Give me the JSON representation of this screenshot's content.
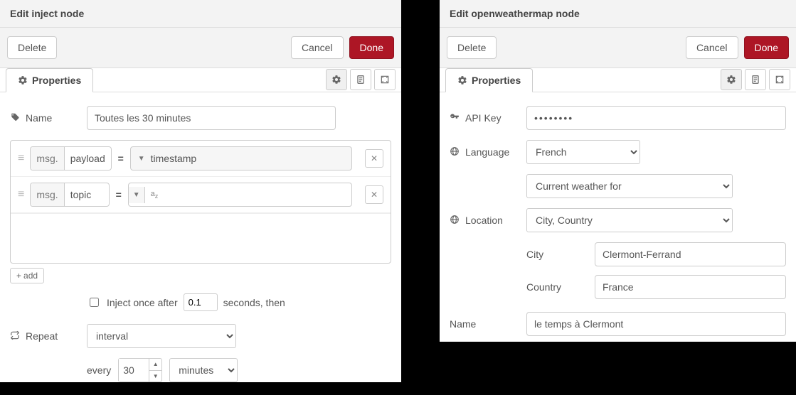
{
  "left": {
    "title": "Edit inject node",
    "delete_label": "Delete",
    "cancel_label": "Cancel",
    "done_label": "Done",
    "tab_label": "Properties",
    "name_label": "Name",
    "name_value": "Toutes les 30 minutes",
    "rows": [
      {
        "prefix": "msg.",
        "field": "payload",
        "type_label": "timestamp",
        "type_icon": "clock"
      },
      {
        "prefix": "msg.",
        "field": "topic",
        "type_label": "",
        "type_icon": "az"
      }
    ],
    "add_label": "add",
    "inject_once_label_a": "Inject once after",
    "inject_once_seconds": "0.1",
    "inject_once_label_b": "seconds, then",
    "repeat_label": "Repeat",
    "repeat_mode": "interval",
    "every_label": "every",
    "interval_value": "30",
    "interval_unit": "minutes"
  },
  "right": {
    "title": "Edit openweathermap node",
    "delete_label": "Delete",
    "cancel_label": "Cancel",
    "done_label": "Done",
    "tab_label": "Properties",
    "apikey_label": "API Key",
    "apikey_value": "••••••••",
    "language_label": "Language",
    "language_value": "French",
    "query_value": "Current weather for",
    "location_label": "Location",
    "location_value": "City, Country",
    "city_label": "City",
    "city_value": "Clermont-Ferrand",
    "country_label": "Country",
    "country_value": "France",
    "name_label": "Name",
    "name_value": "le temps à Clermont"
  }
}
